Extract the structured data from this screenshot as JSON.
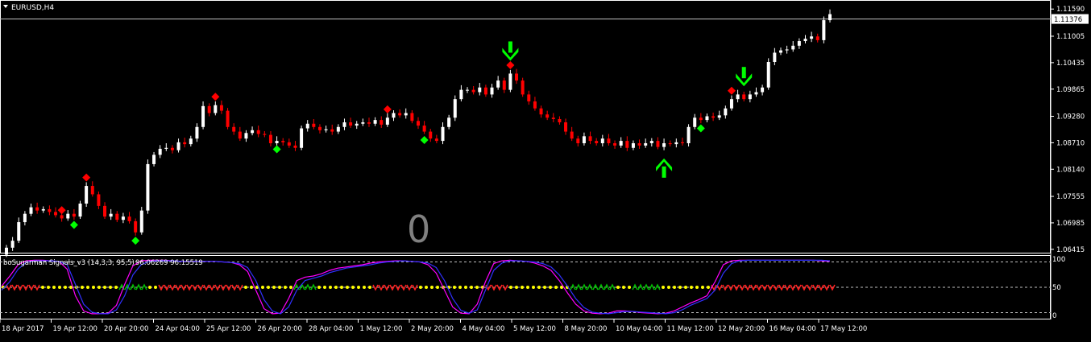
{
  "symbol_label": "EURUSD,H4",
  "indicator_label": "boSugarman Signals_v3 (14,3,3, 95,5)",
  "indicator_values": "96.06269 96.15519",
  "big_counter": "0",
  "current_price": "1.11376",
  "colors": {
    "background": "#000000",
    "bull_candle": "#ffffff",
    "bear_candle": "#ff0000",
    "axis_text": "#ffffff",
    "grid_dashed": "#c0c0c0",
    "arrow_green": "#00ff00",
    "diamond_red": "#ff0000",
    "diamond_green": "#00ff00",
    "k_line": "#ff00ff",
    "d_line": "#3030ff",
    "mid_dots": "#ffff00",
    "counter_gray": "#808080"
  },
  "chart_data": [
    {
      "type": "candlestick",
      "title": "EURUSD,H4",
      "y_axis_ticks": [
        "1.11590",
        "1.11005",
        "1.10435",
        "1.09865",
        "1.09280",
        "1.08710",
        "1.08140",
        "1.07555",
        "1.06985",
        "1.06415"
      ],
      "ylim": [
        1.0636,
        1.1175
      ],
      "x_axis_ticks": [
        "18 Apr 2017",
        "19 Apr 12:00",
        "20 Apr 20:00",
        "24 Apr 04:00",
        "25 Apr 12:00",
        "26 Apr 20:00",
        "28 Apr 04:00",
        "1 May 12:00",
        "2 May 20:00",
        "4 May 04:00",
        "5 May 12:00",
        "8 May 20:00",
        "10 May 04:00",
        "11 May 12:00",
        "12 May 20:00",
        "16 May 04:00",
        "17 May 12:00"
      ],
      "current_price": 1.11376,
      "close": [
        1.0645,
        1.066,
        1.07,
        1.0718,
        1.0732,
        1.0725,
        1.0728,
        1.0722,
        1.0715,
        1.0708,
        1.0718,
        1.0712,
        1.074,
        1.0778,
        1.076,
        1.0735,
        1.0712,
        1.0718,
        1.0705,
        1.0712,
        1.0702,
        1.0678,
        1.0725,
        1.0825,
        1.0845,
        1.0858,
        1.086,
        1.0855,
        1.0872,
        1.0868,
        1.088,
        1.0905,
        1.095,
        1.0935,
        1.0952,
        1.094,
        1.0905,
        1.0895,
        1.088,
        1.0892,
        1.0898,
        1.089,
        1.0888,
        1.087,
        1.0875,
        1.0872,
        1.0865,
        1.086,
        1.0902,
        1.0912,
        1.0905,
        1.0898,
        1.09,
        1.0895,
        1.0905,
        1.0915,
        1.0908,
        1.0912,
        1.0915,
        1.0912,
        1.092,
        1.091,
        1.0925,
        1.0935,
        1.093,
        1.0935,
        1.0918,
        1.0908,
        1.0895,
        1.088,
        1.0875,
        1.0905,
        1.0925,
        1.0965,
        1.0985,
        1.0985,
        1.098,
        1.099,
        1.0975,
        1.099,
        1.1005,
        1.0985,
        1.102,
        1.1005,
        1.0975,
        1.096,
        1.0945,
        1.0932,
        1.0925,
        1.0922,
        1.0915,
        1.0895,
        1.088,
        1.087,
        1.0885,
        1.0875,
        1.087,
        1.088,
        1.087,
        1.0865,
        1.0875,
        1.086,
        1.087,
        1.0865,
        1.087,
        1.0875,
        1.0862,
        1.087,
        1.0868,
        1.0872,
        1.087,
        1.0905,
        1.0925,
        1.092,
        1.0928,
        1.0925,
        1.093,
        1.0945,
        1.0965,
        1.0975,
        1.0965,
        1.0975,
        1.098,
        1.099,
        1.1045,
        1.1065,
        1.107,
        1.1072,
        1.108,
        1.109,
        1.1095,
        1.11,
        1.1092,
        1.1135,
        1.1148
      ]
    },
    {
      "type": "line",
      "title": "boSugarman Signals_v3 (14,3,3, 95,5)",
      "y_axis_ticks": [
        "100",
        "50",
        "0"
      ],
      "ylim": [
        0,
        100
      ],
      "series": [
        {
          "name": "96.06269",
          "values": [
            52,
            70,
            90,
            97,
            98,
            98,
            97,
            96,
            82,
            35,
            8,
            3,
            3,
            4,
            18,
            55,
            88,
            97,
            98,
            98,
            98,
            97,
            96,
            96,
            96,
            96,
            96,
            95,
            94,
            90,
            78,
            45,
            12,
            3,
            4,
            30,
            62,
            68,
            70,
            74,
            80,
            84,
            86,
            88,
            90,
            93,
            95,
            96,
            97,
            97,
            96,
            95,
            90,
            75,
            45,
            15,
            4,
            3,
            20,
            60,
            92,
            97,
            98,
            97,
            96,
            93,
            88,
            80,
            62,
            40,
            20,
            8,
            4,
            3,
            4,
            8,
            8,
            7,
            5,
            4,
            3,
            4,
            8,
            15,
            22,
            28,
            35,
            60,
            90,
            97,
            98,
            98,
            98,
            98,
            98,
            98,
            98,
            98,
            98,
            98,
            97,
            96
          ]
        },
        {
          "name": "96.15519",
          "values": [
            45,
            60,
            82,
            94,
            97,
            97,
            97,
            96,
            90,
            55,
            20,
            6,
            3,
            3,
            10,
            35,
            72,
            90,
            96,
            97,
            97,
            97,
            96,
            96,
            96,
            96,
            96,
            95,
            94,
            92,
            85,
            62,
            28,
            8,
            3,
            15,
            45,
            62,
            66,
            70,
            76,
            80,
            84,
            86,
            88,
            90,
            93,
            95,
            96,
            97,
            96,
            95,
            93,
            85,
            62,
            30,
            9,
            4,
            10,
            45,
            80,
            93,
            97,
            97,
            96,
            95,
            92,
            86,
            72,
            52,
            30,
            14,
            6,
            4,
            3,
            5,
            7,
            7,
            6,
            5,
            4,
            3,
            5,
            10,
            18,
            24,
            30,
            45,
            75,
            92,
            97,
            98,
            98,
            98,
            98,
            98,
            98,
            98,
            98,
            98,
            98,
            97
          ]
        }
      ]
    }
  ]
}
